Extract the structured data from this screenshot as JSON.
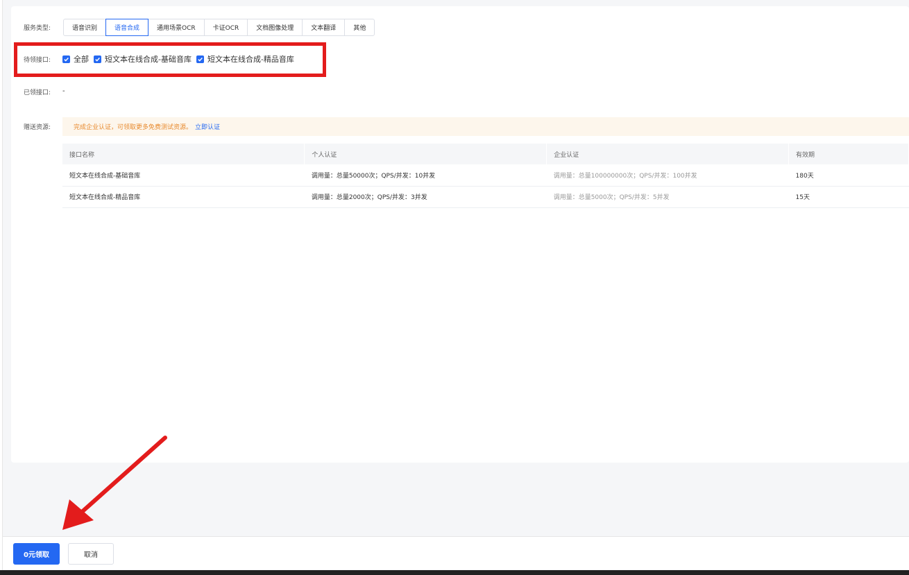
{
  "form": {
    "service_type_label": "服务类型:",
    "tabs": [
      "语音识别",
      "语音合成",
      "通用场景OCR",
      "卡证OCR",
      "文档图像处理",
      "文本翻译",
      "其他"
    ],
    "active_tab_index": 1,
    "pending_label": "待领接口:",
    "pending_options": [
      {
        "label": "全部",
        "checked": true
      },
      {
        "label": "短文本在线合成-基础音库",
        "checked": true
      },
      {
        "label": "短文本在线合成-精品音库",
        "checked": true
      }
    ],
    "claimed_label": "已领接口:",
    "claimed_value": "-",
    "gift_label": "赠送资源:",
    "notice_text": "完成企业认证，可领取更多免费测试资源。",
    "notice_link": "立即认证"
  },
  "table": {
    "headers": [
      "接口名称",
      "个人认证",
      "企业认证",
      "有效期"
    ],
    "rows": [
      [
        "短文本在线合成-基础音库",
        "调用量：总量50000次；QPS/并发：10并发",
        "调用量：总量100000000次；QPS/并发：100并发",
        "180天"
      ],
      [
        "短文本在线合成-精品音库",
        "调用量：总量2000次；QPS/并发：3并发",
        "调用量：总量5000次；QPS/并发：5并发",
        "15天"
      ]
    ]
  },
  "footer": {
    "claim_button": "0元领取",
    "cancel_button": "取消"
  },
  "colors": {
    "accent": "#2468f2",
    "annotation_red": "#e31c1c",
    "notice_text": "#e88a2e"
  },
  "icons": [
    "checkbox-checked-icon",
    "annotation-arrow-icon"
  ]
}
